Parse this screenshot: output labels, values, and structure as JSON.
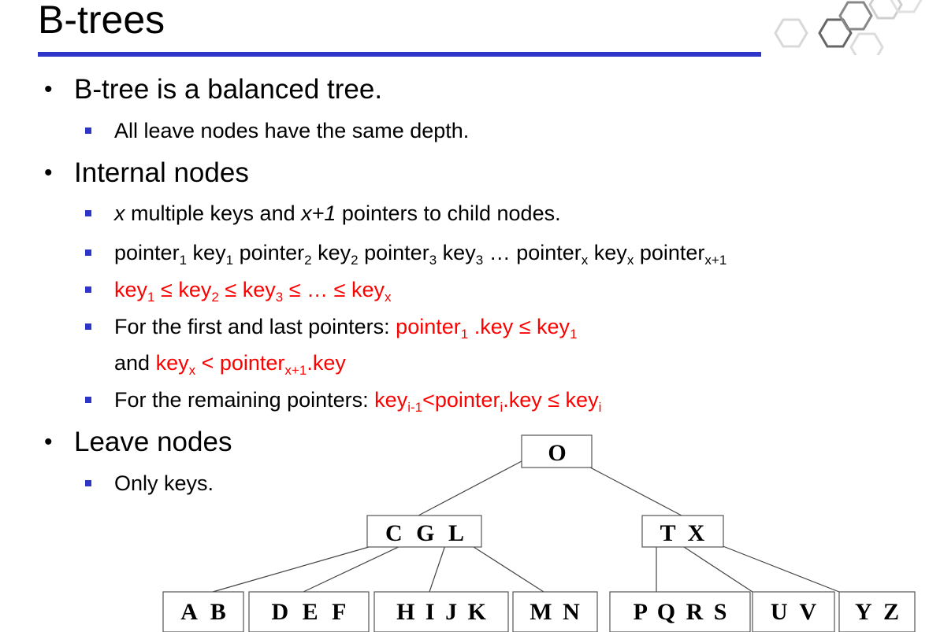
{
  "title": "B-trees",
  "colors": {
    "accent": "#2e35c8",
    "highlight": "#ff0000"
  },
  "bullets": {
    "b1": "B-tree is a balanced tree.",
    "b1_1": "All leave nodes have the same depth.",
    "b2": "Internal nodes",
    "b2_1": {
      "x1": "x",
      "t1": " multiple keys and ",
      "x2": "x+1",
      "t2": " pointers to child nodes."
    },
    "b2_2": {
      "p": "pointer",
      "k": "key",
      "s1": "1",
      "s2": "2",
      "s3": "3",
      "sx": "x",
      "sx1": "x+1",
      "ellipsis": "…"
    },
    "b2_3": {
      "k": "key",
      "le": "≤",
      "ellipsis": "…"
    },
    "b2_4": {
      "prefix": "For the first and last pointers: ",
      "red1a": "pointer",
      "red1b": " .key ≤ key",
      "line2_prefix": "and ",
      "red2a": "key",
      "red2b": " < pointer",
      "red2c": ".key"
    },
    "b2_5": {
      "prefix": "For the remaining pointers: ",
      "r1": "key",
      "s_im1": "i-1",
      "r2": "<pointer",
      "s_i": "i",
      "r3": ".key ≤ key"
    },
    "b3": "Leave nodes",
    "b3_1": "Only keys."
  },
  "tree": {
    "root": "O",
    "level1": [
      "C G L",
      "T X"
    ],
    "leaves": [
      "A B",
      "D E F",
      "H I J K",
      "M N",
      "P Q R S",
      "U V",
      "Y Z"
    ]
  }
}
